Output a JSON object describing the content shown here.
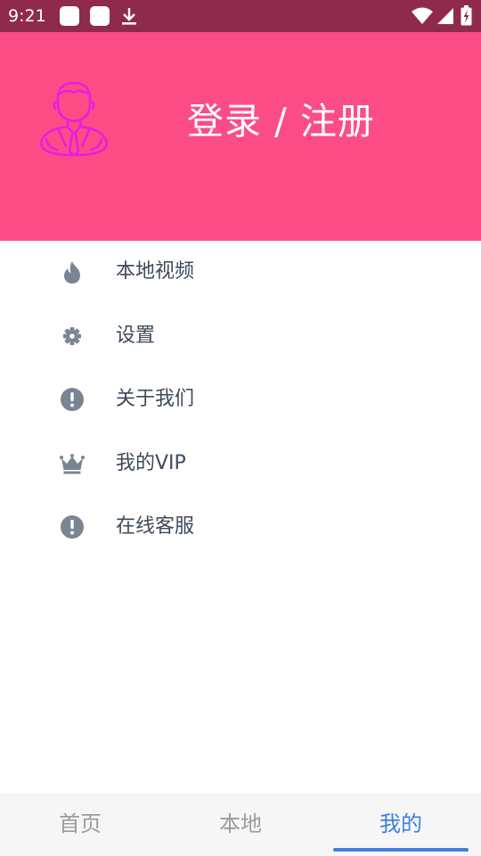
{
  "status_bar": {
    "time": "9:21",
    "icons": [
      "notification-square-icon",
      "notification-square-icon",
      "download-icon",
      "wifi-icon",
      "cell-signal-icon",
      "battery-charging-icon"
    ]
  },
  "header": {
    "avatar_icon": "user-avatar-icon",
    "login_label": "登录 / 注册",
    "background_color": "#fb4c86",
    "avatar_color": "#e81ee0"
  },
  "menu": {
    "items": [
      {
        "label": "本地视频",
        "icon": "flame-icon"
      },
      {
        "label": "设置",
        "icon": "gear-icon"
      },
      {
        "label": "关于我们",
        "icon": "info-alert-icon"
      },
      {
        "label": "我的VIP",
        "icon": "crown-icon"
      },
      {
        "label": "在线客服",
        "icon": "info-alert-icon"
      }
    ],
    "icon_color": "#7a8593",
    "text_color": "#3e4a5a"
  },
  "bottom_nav": {
    "tabs": [
      {
        "label": "首页",
        "active": false
      },
      {
        "label": "本地",
        "active": false
      },
      {
        "label": "我的",
        "active": true
      }
    ],
    "active_color": "#3f7fe0",
    "inactive_color": "#9c9c9c"
  }
}
